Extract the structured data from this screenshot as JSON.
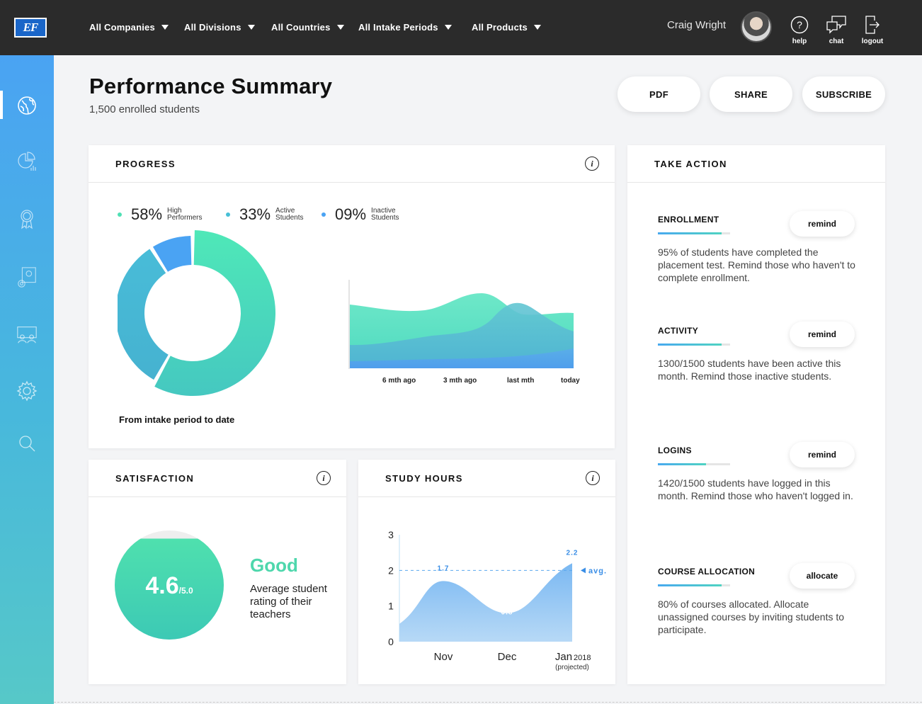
{
  "header": {
    "filters": [
      {
        "label": "All Companies"
      },
      {
        "label": "All Divisions"
      },
      {
        "label": "All Countries"
      },
      {
        "label": "All Intake Periods"
      },
      {
        "label": "All Products"
      }
    ],
    "user_name": "Craig Wright",
    "tools": [
      {
        "label": "help",
        "icon": "help-icon"
      },
      {
        "label": "chat",
        "icon": "chat-icon"
      },
      {
        "label": "logout",
        "icon": "logout-icon"
      }
    ]
  },
  "sidebar": {
    "items": [
      {
        "icon": "globe-icon",
        "active": true
      },
      {
        "icon": "pie-chart-icon"
      },
      {
        "icon": "award-icon"
      },
      {
        "icon": "content-settings-icon"
      },
      {
        "icon": "classroom-icon"
      },
      {
        "icon": "gear-icon"
      },
      {
        "icon": "search-icon"
      }
    ]
  },
  "page": {
    "title": "Performance Summary",
    "subtitle": "1,500 enrolled students",
    "actions": [
      "PDF",
      "SHARE",
      "SUBSCRIBE"
    ]
  },
  "progress": {
    "title": "PROGRESS",
    "legend": [
      {
        "pct": "58%",
        "line1": "High",
        "line2": "Performers",
        "color": "#4fe0b4"
      },
      {
        "pct": "33%",
        "line1": "Active",
        "line2": "Students",
        "color": "#47bfd6"
      },
      {
        "pct": "09%",
        "line1": "Inactive",
        "line2": "Students",
        "color": "#4aa3f3"
      }
    ],
    "caption": "From intake period to date",
    "area_x_labels": [
      "6 mth ago",
      "3 mth ago",
      "last mth",
      "today"
    ]
  },
  "satisfaction": {
    "title": "SATISFACTION",
    "score": "4.6",
    "scale": "/5.0",
    "rating": "Good",
    "description": "Average student rating of their teachers",
    "colors": {
      "accent": "#4ed7ac",
      "track": "#eeeeee"
    }
  },
  "study_hours": {
    "title": "STUDY HOURS",
    "avg_label": "avg.",
    "jan_suffix": "2018",
    "projected": "(projected)"
  },
  "chart_data": [
    {
      "type": "pie",
      "categories": [
        "High Performers",
        "Active Students",
        "Inactive Students"
      ],
      "values": [
        58,
        33,
        9
      ]
    },
    {
      "type": "area",
      "categories": [
        "Nov",
        "Dec",
        "Jan"
      ],
      "values": [
        1.7,
        0.8,
        2.2
      ],
      "data_labels": [
        "1.7",
        "0.8",
        "2.2"
      ],
      "yticks": [
        "3",
        "2",
        "1",
        "0"
      ],
      "ylim": [
        0,
        3
      ],
      "avg": 2,
      "grid": false
    }
  ],
  "take_action": {
    "title": "TAKE ACTION",
    "items": [
      {
        "title": "ENROLLMENT",
        "button": "remind",
        "progress": 0.88,
        "text": "95% of students have completed the placement test. Remind those who haven't to complete enrollment."
      },
      {
        "title": "ACTIVITY",
        "button": "remind",
        "progress": 0.88,
        "text": "1300/1500 students have been active this month. Remind those inactive students."
      },
      {
        "title": "LOGINS",
        "button": "remind",
        "progress": 0.67,
        "text": "1420/1500 students have logged in this month. Remind those who haven't logged in."
      },
      {
        "title": "COURSE ALLOCATION",
        "button": "allocate",
        "progress": 0.88,
        "text": "80% of courses allocated. Allocate unassigned courses by inviting students to participate."
      }
    ]
  }
}
